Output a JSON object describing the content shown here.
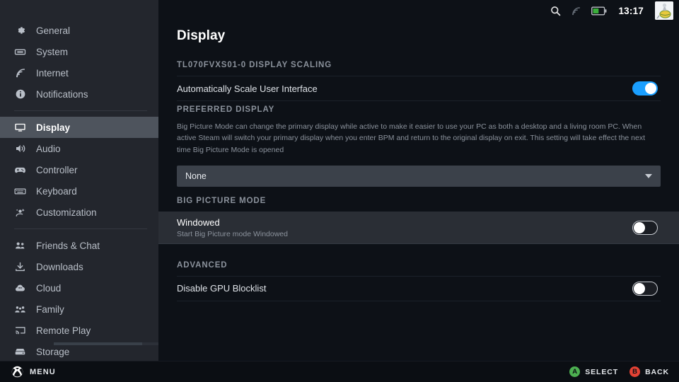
{
  "statusbar": {
    "search_icon": "search-icon",
    "network_icon": "wifi-signal-icon",
    "battery_icon": "battery-icon",
    "clock": "13:17",
    "avatar_icon": "user-avatar"
  },
  "sidebar": {
    "groups": [
      {
        "items": [
          {
            "label": "General",
            "icon": "gear-icon",
            "active": false
          },
          {
            "label": "System",
            "icon": "handheld-device-icon",
            "active": false
          },
          {
            "label": "Internet",
            "icon": "wifi-icon",
            "active": false
          },
          {
            "label": "Notifications",
            "icon": "notification-bell-icon",
            "active": false
          }
        ]
      },
      {
        "items": [
          {
            "label": "Display",
            "icon": "monitor-icon",
            "active": true
          },
          {
            "label": "Audio",
            "icon": "speaker-icon",
            "active": false
          },
          {
            "label": "Controller",
            "icon": "gamepad-icon",
            "active": false
          },
          {
            "label": "Keyboard",
            "icon": "keyboard-icon",
            "active": false
          },
          {
            "label": "Customization",
            "icon": "customization-icon",
            "active": false
          }
        ]
      },
      {
        "items": [
          {
            "label": "Friends & Chat",
            "icon": "friends-icon",
            "active": false
          },
          {
            "label": "Downloads",
            "icon": "download-icon",
            "active": false
          },
          {
            "label": "Cloud",
            "icon": "cloud-icon",
            "active": false
          },
          {
            "label": "Family",
            "icon": "family-icon",
            "active": false
          },
          {
            "label": "Remote Play",
            "icon": "remote-play-icon",
            "active": false
          },
          {
            "label": "Storage",
            "icon": "storage-icon",
            "active": false
          }
        ]
      }
    ]
  },
  "main": {
    "page_title": "Display",
    "sections": [
      {
        "heading": "TL070FVXS01-0 DISPLAY SCALING",
        "description": "",
        "rows": [
          {
            "type": "toggle",
            "label": "Automatically Scale User Interface",
            "sub": "",
            "state": "on",
            "name": "auto-scale-ui"
          }
        ]
      },
      {
        "heading": "PREFERRED DISPLAY",
        "description": "Big Picture Mode can change the primary display while active to make it easier to use your PC as both a desktop and a living room PC. When active Steam will switch your primary display when you enter BPM and return to the original display on exit. This setting will take effect the next time Big Picture Mode is opened",
        "rows": [
          {
            "type": "dropdown",
            "label": "",
            "value": "None",
            "name": "preferred-display-select"
          }
        ]
      },
      {
        "heading": "BIG PICTURE MODE",
        "description": "",
        "rows": [
          {
            "type": "toggle",
            "label": "Windowed",
            "sub": "Start Big Picture mode Windowed",
            "state": "off",
            "focused": true,
            "name": "big-picture-windowed"
          }
        ]
      },
      {
        "heading": "ADVANCED",
        "description": "",
        "rows": [
          {
            "type": "toggle",
            "label": "Disable GPU Blocklist",
            "sub": "",
            "state": "off",
            "name": "disable-gpu-blocklist"
          }
        ]
      }
    ]
  },
  "footer": {
    "menu_label": "MENU",
    "menu_icon": "xbox-guide-icon",
    "hints": [
      {
        "button": "A",
        "label": "SELECT",
        "color": "#4caf50"
      },
      {
        "button": "B",
        "label": "BACK",
        "color": "#e34234"
      }
    ]
  },
  "colors": {
    "accent_blue": "#1a9fff",
    "sidebar_bg": "#23262d",
    "main_bg": "#0d1117",
    "active_row": "#4e545d"
  }
}
